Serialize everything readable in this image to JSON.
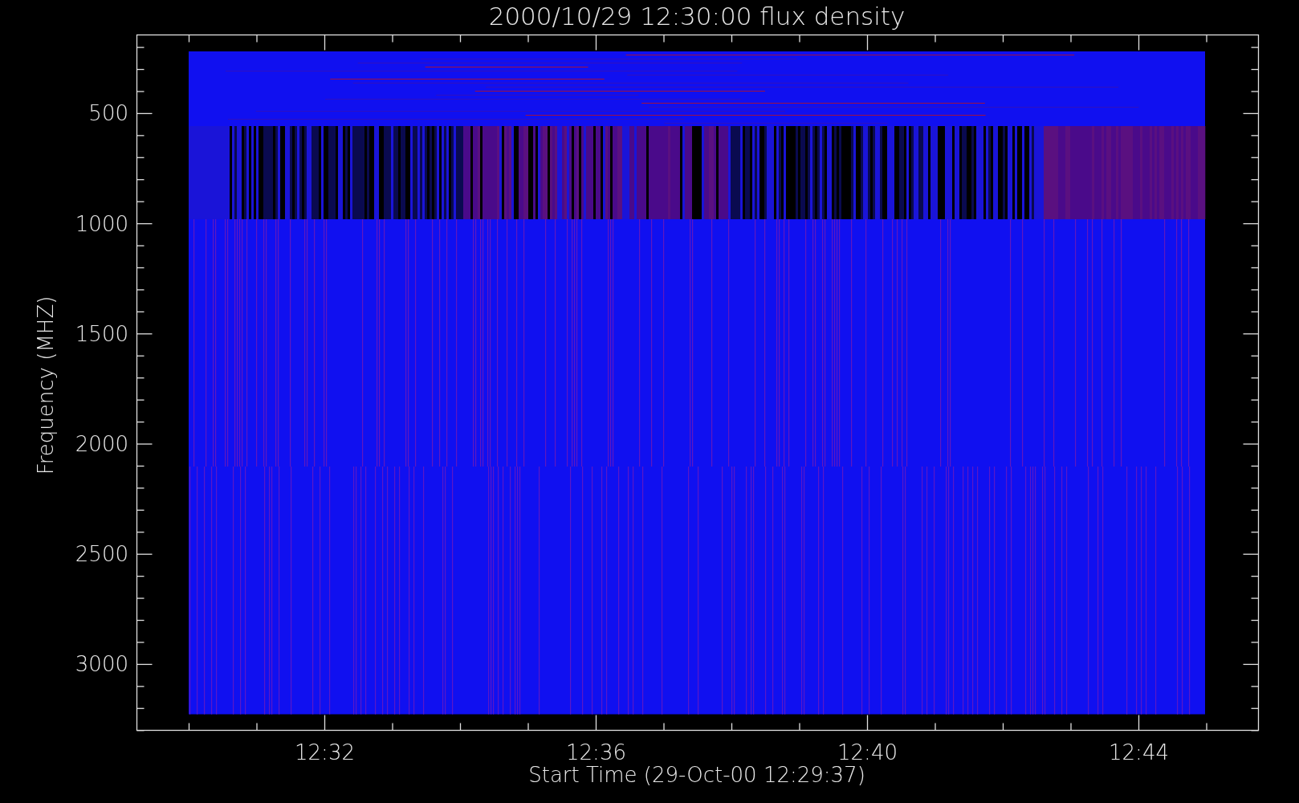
{
  "plot": {
    "title": "2000/10/29 12:30:00 flux density",
    "y_axis": {
      "label": "Frequency (MHZ)",
      "ticks": [
        "500",
        "1000",
        "1500",
        "2000",
        "2500",
        "3000"
      ]
    },
    "x_axis": {
      "label": "Start Time (29-Oct-00 12:29:37)",
      "ticks": [
        "12:32",
        "12:36",
        "12:40",
        "12:44"
      ]
    }
  }
}
